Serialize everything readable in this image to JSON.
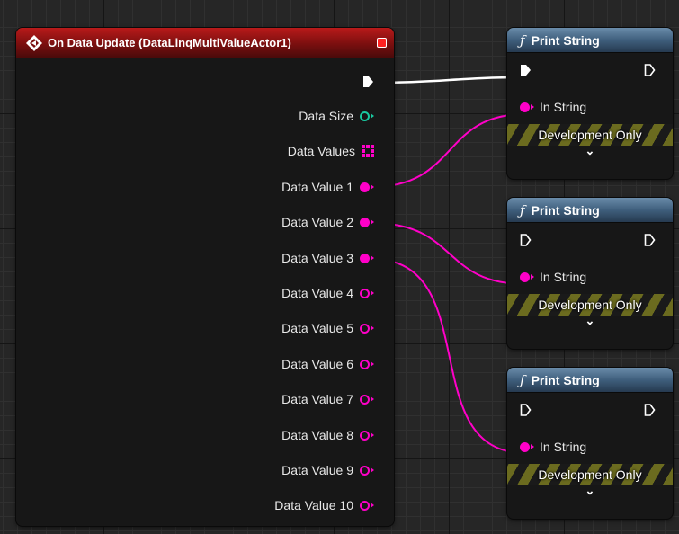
{
  "event_node": {
    "title": "On Data Update (DataLinqMultiValueActor1)",
    "pins": [
      {
        "label": "Data Size",
        "type": "integer",
        "color": "#19c9a0",
        "connected": false
      },
      {
        "label": "Data Values",
        "type": "string-array",
        "color": "#ff00c8",
        "connected": false
      },
      {
        "label": "Data Value 1",
        "type": "string",
        "color": "#ff00c8",
        "connected": true
      },
      {
        "label": "Data Value 2",
        "type": "string",
        "color": "#ff00c8",
        "connected": true
      },
      {
        "label": "Data Value 3",
        "type": "string",
        "color": "#ff00c8",
        "connected": true
      },
      {
        "label": "Data Value 4",
        "type": "string",
        "color": "#ff00c8",
        "connected": false
      },
      {
        "label": "Data Value 5",
        "type": "string",
        "color": "#ff00c8",
        "connected": false
      },
      {
        "label": "Data Value 6",
        "type": "string",
        "color": "#ff00c8",
        "connected": false
      },
      {
        "label": "Data Value 7",
        "type": "string",
        "color": "#ff00c8",
        "connected": false
      },
      {
        "label": "Data Value 8",
        "type": "string",
        "color": "#ff00c8",
        "connected": false
      },
      {
        "label": "Data Value 9",
        "type": "string",
        "color": "#ff00c8",
        "connected": false
      },
      {
        "label": "Data Value 10",
        "type": "string",
        "color": "#ff00c8",
        "connected": false
      }
    ]
  },
  "print_nodes": [
    {
      "title": "Print String",
      "in_label": "In String",
      "badge": "Development Only",
      "icon": "function-icon",
      "exec_in_connected": true
    },
    {
      "title": "Print String",
      "in_label": "In String",
      "badge": "Development Only",
      "icon": "function-icon",
      "exec_in_connected": false
    },
    {
      "title": "Print String",
      "in_label": "In String",
      "badge": "Development Only",
      "icon": "function-icon",
      "exec_in_connected": false
    }
  ],
  "colors": {
    "exec": "#ffffff",
    "string": "#ff00c8",
    "integer": "#19c9a0",
    "event_header": "#b91a1a",
    "function_header": "#4f7090"
  }
}
